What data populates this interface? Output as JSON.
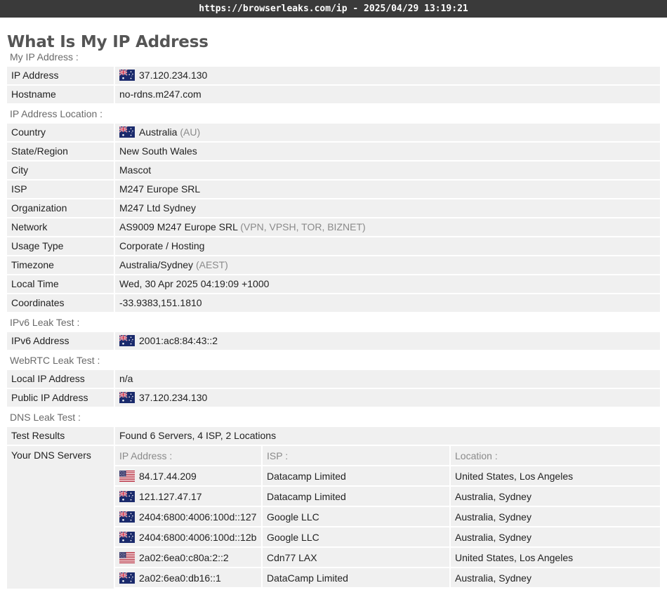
{
  "browser": {
    "url_bar": "https://browserleaks.com/ip - 2025/04/29 13:19:21"
  },
  "page": {
    "title": "What Is My IP Address"
  },
  "sections": {
    "my_ip": {
      "title": "My IP Address :",
      "ip_label": "IP Address",
      "ip_value": "37.120.234.130",
      "hostname_label": "Hostname",
      "hostname_value": "no-rdns.m247.com"
    },
    "location": {
      "title": "IP Address Location :",
      "country_label": "Country",
      "country_value": "Australia",
      "country_code": "(AU)",
      "state_label": "State/Region",
      "state_value": "New South Wales",
      "city_label": "City",
      "city_value": "Mascot",
      "isp_label": "ISP",
      "isp_value": "M247 Europe SRL",
      "org_label": "Organization",
      "org_value": "M247 Ltd Sydney",
      "network_label": "Network",
      "network_value": "AS9009 M247 Europe SRL",
      "network_tags": "(VPN, VPSH, TOR, BIZNET)",
      "usage_label": "Usage Type",
      "usage_value": "Corporate / Hosting",
      "timezone_label": "Timezone",
      "timezone_value": "Australia/Sydney",
      "timezone_abbr": "(AEST)",
      "localtime_label": "Local Time",
      "localtime_value": "Wed, 30 Apr 2025 04:19:09 +1000",
      "coords_label": "Coordinates",
      "coords_value": "-33.9383,151.1810"
    },
    "ipv6": {
      "title": "IPv6 Leak Test :",
      "addr_label": "IPv6 Address",
      "addr_value": "2001:ac8:84:43::2"
    },
    "webrtc": {
      "title": "WebRTC Leak Test :",
      "local_label": "Local IP Address",
      "local_value": "n/a",
      "public_label": "Public IP Address",
      "public_value": "37.120.234.130"
    },
    "dns": {
      "title": "DNS Leak Test :",
      "results_label": "Test Results",
      "results_value": "Found 6 Servers, 4 ISP, 2 Locations",
      "servers_label": "Your DNS Servers",
      "headers": [
        "IP Address :",
        "ISP :",
        "Location :"
      ],
      "rows": [
        {
          "flag": "us-flag-icon",
          "ip": "84.17.44.209",
          "isp": "Datacamp Limited",
          "location": "United States, Los Angeles"
        },
        {
          "flag": "au-flag-icon",
          "ip": "121.127.47.17",
          "isp": "Datacamp Limited",
          "location": "Australia, Sydney"
        },
        {
          "flag": "au-flag-icon",
          "ip": "2404:6800:4006:100d::127",
          "isp": "Google LLC",
          "location": "Australia, Sydney"
        },
        {
          "flag": "au-flag-icon",
          "ip": "2404:6800:4006:100d::12b",
          "isp": "Google LLC",
          "location": "Australia, Sydney"
        },
        {
          "flag": "us-flag-icon",
          "ip": "2a02:6ea0:c80a:2::2",
          "isp": "Cdn77 LAX",
          "location": "United States, Los Angeles"
        },
        {
          "flag": "au-flag-icon",
          "ip": "2a02:6ea0:db16::1",
          "isp": "DataCamp Limited",
          "location": "Australia, Sydney"
        }
      ]
    }
  }
}
